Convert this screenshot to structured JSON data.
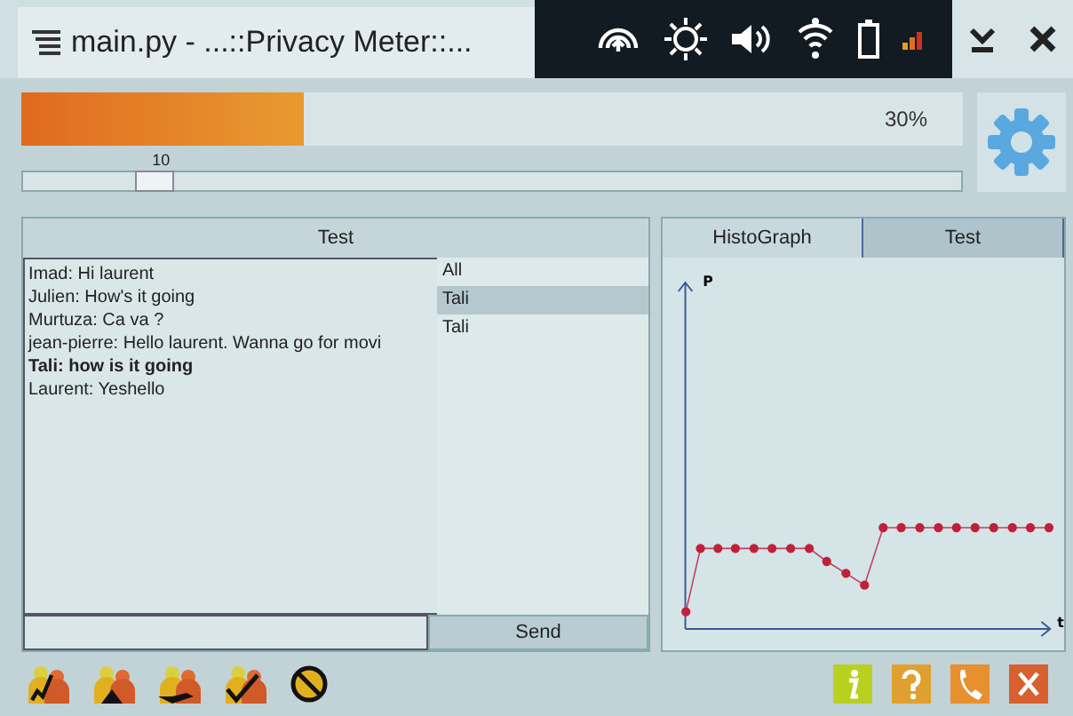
{
  "window": {
    "title": "main.py - ...::Privacy Meter::..."
  },
  "privacy_meter": {
    "level": 0.3,
    "reading": "30%"
  },
  "slider": {
    "reading": "10",
    "level": 0.12
  },
  "chat_panel": {
    "title": "Test",
    "messages": [
      {
        "text": "Imad: Hi laurent",
        "bold": false
      },
      {
        "text": "Julien: How's it going",
        "bold": false
      },
      {
        "text": "Murtuza: Ca va ?",
        "bold": false
      },
      {
        "text": "jean-pierre: Hello laurent. Wanna go for movi",
        "bold": false
      },
      {
        "text": "Tali: how is it going",
        "bold": true
      },
      {
        "text": "Laurent: Yeshello",
        "bold": false
      }
    ],
    "recipients": [
      {
        "label": "All",
        "selected": false
      },
      {
        "label": "Tali",
        "selected": true
      },
      {
        "label": "Tali",
        "selected": false
      }
    ],
    "send_button": "Send"
  },
  "graph_panel": {
    "tabs": [
      {
        "label": "HistoGraph",
        "selected": true
      },
      {
        "label": "Test",
        "selected": false
      }
    ],
    "y_axis_label": "P",
    "x_axis_label": "t"
  }
}
